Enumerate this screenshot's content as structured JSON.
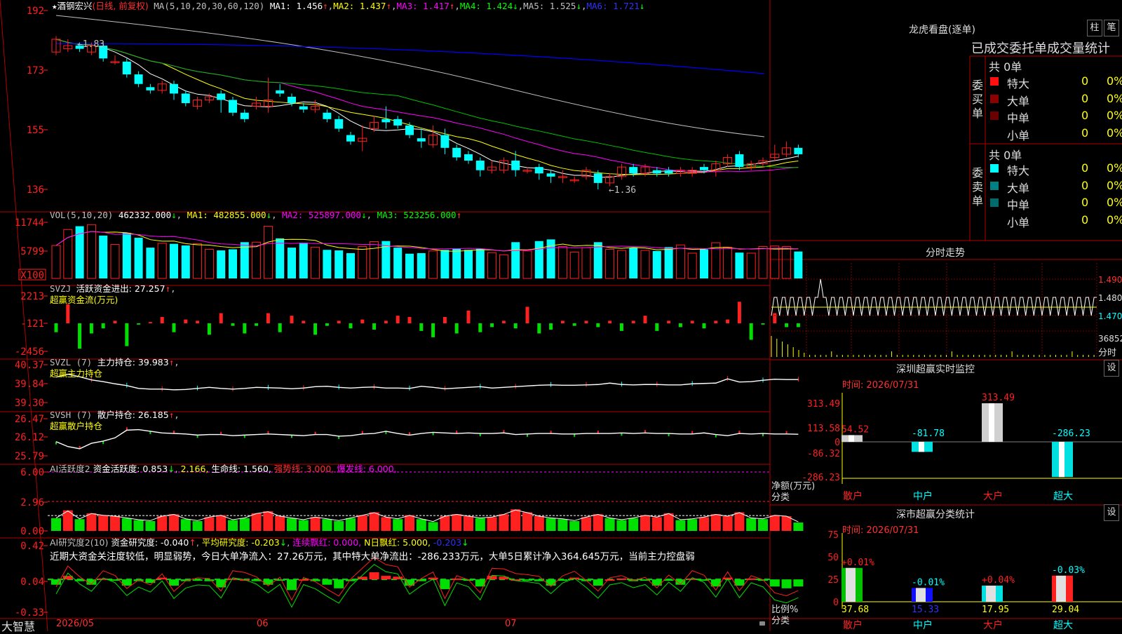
{
  "main_header": {
    "star": "★",
    "stock_name": "酒钢宏兴",
    "period": "(日线, 前复权)",
    "ma_label": "MA(5,10,20,30,60,120)",
    "ma1": "MA1: 1.456",
    "ma2": "MA2: 1.437",
    "ma3": "MA3: 1.417",
    "ma4": "MA4: 1.424",
    "ma5": "MA5: 1.525",
    "ma6": "MA6: 1.721",
    "up_arrow": "↑",
    "down_arrow": "↓"
  },
  "vol_header": {
    "label": "VOL(5,10,20)",
    "value": "462332.000",
    "ma1": "MA1: 482855.000",
    "ma2": "MA2: 525897.000",
    "ma3": "MA3: 523256.000"
  },
  "svzj_header": {
    "line1_a": "SVZJ",
    "line1_b": "活跃资金进出: 27.257",
    "line2": "超赢资金流(万元)"
  },
  "svzl_header": {
    "line1_a": "SVZL (7)",
    "line1_b": "主力持仓: 39.983",
    "line2": "超赢主力持仓"
  },
  "svsh_header": {
    "line1_a": "SVSH (7)",
    "line1_b": "散户持仓: 26.185",
    "line2": "超赢散户持仓"
  },
  "ai_header": {
    "a": "AI活跃度2",
    "b": "资金活跃度: 0.853",
    "c": "2.166,",
    "d": "生命线: 1.560,",
    "e": "强势线: 3.000,",
    "f": "爆发线: 6.000,"
  },
  "ai2_header": {
    "a": "AI研究度2(10)",
    "b": "资金研究度: -0.040",
    "c": "平均研究度: -0.203",
    "d": "连续飘红: 0.000,",
    "e": "N日飘红: 5.000,",
    "f": "-0.203"
  },
  "comment": "近期大资金关注度较低，明显弱势，今日大单净流入：27.26万元，其中特大单净流出：-286.233万元，大单5日累计净入364.645万元，当前主力控盘弱",
  "axis": {
    "main": [
      "192",
      "173",
      "155",
      "136"
    ],
    "vol": [
      "11744",
      "5799",
      "X100"
    ],
    "svzj": [
      "2213",
      "-121",
      "-2456"
    ],
    "svzl": [
      "40.37",
      "39.84",
      "39.30"
    ],
    "svsh": [
      "26.47",
      "26.12",
      "25.79"
    ],
    "ai": [
      "6.00",
      "2.96",
      "0.00"
    ],
    "ai2": [
      "0.42",
      "0.04",
      "-0.33"
    ]
  },
  "annotations": {
    "high": "←1.83",
    "low": "←1.36"
  },
  "bottom": {
    "brand": "大智慧",
    "date1": "2026/05",
    "date2": "06",
    "date3": "07"
  },
  "right": {
    "lhb_title": "龙虎看盘(逐单)",
    "btn_zhu": "柱",
    "btn_bi": "笔",
    "stats_title": "已成交委托单成交量统计",
    "buy_label": "委买单",
    "sell_label": "委卖单",
    "total_buy": "共 0单",
    "total_sell": "共 0单",
    "buy_rows": [
      {
        "name": "特大",
        "num": "0",
        "pct": "0%",
        "color": "#ff1010"
      },
      {
        "name": "大单",
        "num": "0",
        "pct": "0%",
        "color": "#8b0000"
      },
      {
        "name": "中单",
        "num": "0",
        "pct": "0%",
        "color": "#6b0000"
      },
      {
        "name": "小单",
        "num": "0",
        "pct": "0%",
        "color": "#000000"
      }
    ],
    "sell_rows": [
      {
        "name": "特大",
        "num": "0",
        "pct": "0%",
        "color": "#00ffff"
      },
      {
        "name": "大单",
        "num": "0",
        "pct": "0%",
        "color": "#008080"
      },
      {
        "name": "中单",
        "num": "0",
        "pct": "0%",
        "color": "#006b6b"
      },
      {
        "name": "小单",
        "num": "0",
        "pct": "0%",
        "color": "#000000"
      }
    ],
    "fenshi_title": "分时走势",
    "fenshi_prices": [
      "1.490",
      "1.480",
      "1.470"
    ],
    "fenshi_vol": "36852",
    "fenshi_label": "分时",
    "sz_title": "深圳超赢实时监控",
    "sz_btn": "设",
    "sz_time": "时间: 2026/07/31",
    "sz_axis": [
      "313.49",
      "113.58",
      "0",
      "-86.32",
      "-286.23"
    ],
    "sz_ylabel": "净额(万元)",
    "sz_xlabel": "分类",
    "sz_cats": [
      "散户",
      "中户",
      "大户",
      "超大"
    ],
    "sz_values": [
      "54.52",
      "-81.78",
      "313.49",
      "-286.23"
    ],
    "ss_title": "深市超赢分类统计",
    "ss_btn": "设",
    "ss_time": "时间: 2026/07/31",
    "ss_axis": [
      "75",
      "50",
      "25",
      "0"
    ],
    "ss_ylabel": "比例%",
    "ss_xlabel": "分类",
    "ss_cats": [
      "散户",
      "中户",
      "大户",
      "超大"
    ],
    "ss_pct": [
      "+0.01%",
      "-0.01%",
      "+0.04%",
      "-0.03%"
    ],
    "ss_values": [
      "37.68",
      "15.33",
      "17.95",
      "29.04"
    ]
  },
  "chart_data": [
    {
      "type": "candlestick",
      "title": "酒钢宏兴 (日线, 前复权)",
      "ylim": [
        1.36,
        1.92
      ],
      "x_labels": [
        "2026/05",
        "06",
        "07"
      ],
      "ma_series": [
        {
          "name": "MA1",
          "value": 1.456,
          "color": "#ffffff"
        },
        {
          "name": "MA2",
          "value": 1.437,
          "color": "#ffff00"
        },
        {
          "name": "MA3",
          "value": 1.417,
          "color": "#ff00ff"
        },
        {
          "name": "MA4",
          "value": 1.424,
          "color": "#00ff00"
        },
        {
          "name": "MA5",
          "value": 1.525,
          "color": "#c0c0c0"
        },
        {
          "name": "MA6",
          "value": 1.721,
          "color": "#0000ff"
        }
      ],
      "candles": [
        [
          1.79,
          1.83,
          1.84,
          1.78
        ],
        [
          1.8,
          1.81,
          1.83,
          1.79
        ],
        [
          1.81,
          1.8,
          1.82,
          1.79
        ],
        [
          1.79,
          1.81,
          1.82,
          1.78
        ],
        [
          1.81,
          1.77,
          1.82,
          1.76
        ],
        [
          1.76,
          1.76,
          1.78,
          1.75
        ],
        [
          1.76,
          1.72,
          1.77,
          1.71
        ],
        [
          1.72,
          1.69,
          1.73,
          1.68
        ],
        [
          1.68,
          1.67,
          1.69,
          1.66
        ],
        [
          1.67,
          1.69,
          1.7,
          1.66
        ],
        [
          1.69,
          1.66,
          1.7,
          1.64
        ],
        [
          1.66,
          1.63,
          1.67,
          1.62
        ],
        [
          1.62,
          1.64,
          1.65,
          1.61
        ],
        [
          1.64,
          1.65,
          1.66,
          1.63
        ],
        [
          1.66,
          1.64,
          1.67,
          1.6
        ],
        [
          1.64,
          1.6,
          1.65,
          1.59
        ],
        [
          1.6,
          1.58,
          1.61,
          1.57
        ],
        [
          1.62,
          1.63,
          1.65,
          1.61
        ],
        [
          1.62,
          1.64,
          1.71,
          1.6
        ],
        [
          1.67,
          1.66,
          1.69,
          1.65
        ],
        [
          1.65,
          1.63,
          1.66,
          1.62
        ],
        [
          1.62,
          1.61,
          1.63,
          1.6
        ],
        [
          1.61,
          1.62,
          1.64,
          1.6
        ],
        [
          1.6,
          1.58,
          1.61,
          1.57
        ],
        [
          1.58,
          1.55,
          1.59,
          1.54
        ],
        [
          1.53,
          1.51,
          1.54,
          1.5
        ],
        [
          1.51,
          1.52,
          1.56,
          1.48
        ],
        [
          1.55,
          1.57,
          1.59,
          1.54
        ],
        [
          1.58,
          1.57,
          1.62,
          1.55
        ],
        [
          1.58,
          1.56,
          1.59,
          1.55
        ],
        [
          1.56,
          1.53,
          1.57,
          1.52
        ],
        [
          1.52,
          1.51,
          1.55,
          1.49
        ],
        [
          1.5,
          1.53,
          1.56,
          1.49
        ],
        [
          1.53,
          1.49,
          1.55,
          1.47
        ],
        [
          1.49,
          1.46,
          1.5,
          1.45
        ],
        [
          1.47,
          1.45,
          1.48,
          1.44
        ],
        [
          1.45,
          1.42,
          1.46,
          1.4
        ],
        [
          1.42,
          1.43,
          1.45,
          1.41
        ],
        [
          1.42,
          1.45,
          1.46,
          1.41
        ],
        [
          1.45,
          1.42,
          1.48,
          1.4
        ],
        [
          1.42,
          1.42,
          1.43,
          1.41
        ],
        [
          1.43,
          1.41,
          1.44,
          1.39
        ],
        [
          1.41,
          1.4,
          1.42,
          1.38
        ],
        [
          1.4,
          1.4,
          1.42,
          1.38
        ],
        [
          1.39,
          1.39,
          1.4,
          1.38
        ],
        [
          1.4,
          1.42,
          1.43,
          1.39
        ],
        [
          1.41,
          1.38,
          1.42,
          1.36
        ],
        [
          1.38,
          1.4,
          1.41,
          1.37
        ],
        [
          1.4,
          1.43,
          1.44,
          1.39
        ],
        [
          1.43,
          1.41,
          1.44,
          1.4
        ],
        [
          1.41,
          1.43,
          1.44,
          1.4
        ],
        [
          1.42,
          1.41,
          1.43,
          1.4
        ],
        [
          1.42,
          1.41,
          1.43,
          1.4
        ],
        [
          1.41,
          1.42,
          1.43,
          1.4
        ],
        [
          1.41,
          1.42,
          1.43,
          1.4
        ],
        [
          1.43,
          1.42,
          1.44,
          1.41
        ],
        [
          1.42,
          1.44,
          1.45,
          1.4
        ],
        [
          1.44,
          1.46,
          1.47,
          1.43
        ],
        [
          1.47,
          1.43,
          1.48,
          1.42
        ],
        [
          1.43,
          1.44,
          1.45,
          1.42
        ],
        [
          1.44,
          1.45,
          1.46,
          1.43
        ],
        [
          1.46,
          1.47,
          1.5,
          1.45
        ],
        [
          1.47,
          1.49,
          1.51,
          1.46
        ],
        [
          1.49,
          1.47,
          1.5,
          1.46
        ]
      ]
    },
    {
      "type": "bar",
      "title": "VOL(5,10,20)",
      "ylim": [
        0,
        11744
      ],
      "values": [
        6000,
        8900,
        9500,
        9800,
        7800,
        6200,
        8300,
        7400,
        5600,
        6400,
        6300,
        6000,
        6300,
        5300,
        5100,
        5300,
        6600,
        6600,
        9500,
        7300,
        5600,
        6500,
        5700,
        5200,
        5100,
        4600,
        5800,
        6700,
        6800,
        5600,
        4500,
        4600,
        5000,
        5200,
        5400,
        5200,
        5400,
        4700,
        4300,
        6600,
        5000,
        6800,
        7100,
        5800,
        4800,
        5600,
        6600,
        5300,
        5100,
        5600,
        5100,
        5000,
        5700,
        6100,
        4600,
        5300,
        6500,
        5700,
        4700,
        4600,
        5800,
        5900,
        5800,
        4900
      ]
    },
    {
      "type": "bar",
      "title": "SVZJ 活跃资金进出",
      "ylim": [
        -2456,
        2213
      ],
      "values": [
        -700,
        1500,
        -2000,
        -800,
        -400,
        200,
        -1800,
        -100,
        100,
        500,
        -700,
        300,
        200,
        -900,
        800,
        -200,
        -800,
        -200,
        800,
        -700,
        600,
        200,
        -900,
        -200,
        200,
        -400,
        300,
        -500,
        200,
        600,
        500,
        -600,
        -1100,
        500,
        -800,
        1000,
        -700,
        -300,
        200,
        -400,
        1300,
        -800,
        -500,
        200,
        -200,
        200,
        -300,
        200,
        -600,
        200,
        600,
        -600,
        200,
        -300,
        200,
        -400,
        200,
        300,
        1700,
        -1300,
        -100,
        800,
        -300,
        -300
      ]
    },
    {
      "type": "line",
      "title": "SVZL 主力持仓",
      "ylim": [
        39.3,
        40.37
      ],
      "values": [
        40.02,
        40.1,
        40.03,
        39.94,
        39.89,
        39.83,
        39.78,
        39.7,
        39.68,
        39.68,
        39.66,
        39.67,
        39.7,
        39.73,
        39.7,
        39.68,
        39.7,
        39.73,
        39.72,
        39.71,
        39.69,
        39.71,
        39.75,
        39.76,
        39.73,
        39.71,
        39.73,
        39.74,
        39.71,
        39.71,
        39.7,
        39.76,
        39.73,
        39.69,
        39.71,
        39.73,
        39.75,
        39.71,
        39.73,
        39.75,
        39.77,
        39.79,
        39.8,
        39.79,
        39.79,
        39.8,
        39.81,
        39.85,
        39.81,
        39.8,
        39.81,
        39.81,
        39.8,
        39.8,
        39.83,
        39.84,
        39.85,
        39.97,
        39.88,
        39.89,
        39.93,
        39.96,
        39.95,
        39.95
      ]
    },
    {
      "type": "line",
      "title": "SVSH 散户持仓",
      "ylim": [
        25.79,
        26.47
      ],
      "values": [
        26.05,
        25.96,
        25.92,
        26.02,
        26.06,
        26.12,
        26.26,
        26.27,
        26.24,
        26.21,
        26.2,
        26.19,
        26.17,
        26.18,
        26.18,
        26.16,
        26.17,
        26.18,
        26.19,
        26.18,
        26.17,
        26.16,
        26.18,
        26.18,
        26.15,
        26.16,
        26.19,
        26.2,
        26.24,
        26.2,
        26.17,
        26.2,
        26.22,
        26.21,
        26.2,
        26.21,
        26.2,
        26.2,
        26.21,
        26.18,
        26.19,
        26.2,
        26.2,
        26.19,
        26.19,
        26.2,
        26.2,
        26.2,
        26.21,
        26.2,
        26.21,
        26.2,
        26.2,
        26.19,
        26.19,
        26.21,
        26.18,
        26.16,
        26.2,
        26.19,
        26.2,
        26.19,
        26.19,
        26.185
      ]
    },
    {
      "type": "bar",
      "title": "AI活跃度2",
      "ylim": [
        0,
        6.0
      ],
      "values": [
        1.3,
        2.1,
        1.2,
        1.8,
        1.6,
        1.5,
        1.3,
        1.1,
        1.0,
        1.5,
        1.7,
        1.2,
        1.0,
        1.4,
        1.6,
        1.1,
        1.3,
        1.8,
        2.0,
        1.5,
        1.3,
        1.1,
        1.4,
        1.2,
        1.0,
        1.3,
        1.6,
        1.9,
        1.4,
        1.2,
        1.6,
        1.2,
        0.9,
        1.5,
        1.7,
        1.5,
        1.3,
        1.4,
        1.7,
        2.2,
        1.9,
        1.5,
        1.3,
        1.2,
        1.0,
        1.4,
        1.7,
        1.3,
        1.1,
        1.3,
        1.6,
        1.4,
        1.8,
        1.1,
        1.2,
        1.4,
        1.7,
        1.5,
        1.9,
        1.3,
        1.2,
        1.6,
        1.5,
        0.853
      ]
    },
    {
      "type": "bar",
      "title": "AI研究度2(10)",
      "ylim": [
        -0.33,
        0.42
      ],
      "values": [
        -0.02,
        0.08,
        0.02,
        -0.02,
        0.05,
        0.03,
        -0.03,
        0.02,
        0.0,
        0.06,
        -0.03,
        0.02,
        0.03,
        0.02,
        -0.05,
        0.05,
        0.04,
        0.02,
        -0.02,
        0.03,
        -0.08,
        0.04,
        0.02,
        -0.02,
        -0.06,
        0.02,
        0.07,
        0.12,
        0.08,
        0.07,
        -0.03,
        0.02,
        0.06,
        -0.07,
        0.05,
        0.03,
        -0.04,
        0.08,
        0.07,
        0.04,
        0.03,
        0.02,
        -0.03,
        0.03,
        0.06,
        0.02,
        -0.03,
        0.04,
        0.05,
        0.02,
        0.03,
        -0.03,
        0.03,
        -0.02,
        0.05,
        0.03,
        -0.04,
        0.06,
        -0.03,
        0.05,
        0.03,
        -0.04,
        -0.06,
        -0.04
      ]
    }
  ]
}
